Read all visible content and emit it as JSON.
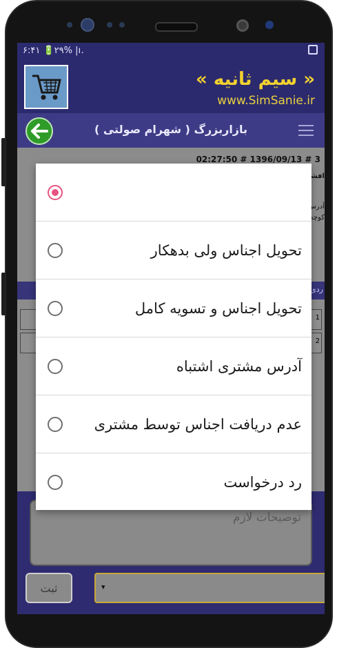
{
  "status_bar": {
    "left_text": "۶:۴۱ 🔋۲۹% |ı.",
    "right_icon": "image-icon"
  },
  "brand": {
    "title": "« سیم ثانیه »",
    "url": "www.SimSanie.ir",
    "title_color": "#f1d12f"
  },
  "nav": {
    "title": "بازاربزرگ ( شهرام صولتی )"
  },
  "background": {
    "order_line": "02:27:50 # 1396/09/13 # 3",
    "peek_1": "افشی",
    "peek_2": "آدرس",
    "peek_3": "کوچه",
    "table_header": "ردی",
    "row_1": "1",
    "row_2": "2"
  },
  "dialog": {
    "options": [
      {
        "label": "",
        "selected": true
      },
      {
        "label": "تحویل اجناس ولی بدهکار",
        "selected": false
      },
      {
        "label": "تحویل اجناس و تسویه کامل",
        "selected": false
      },
      {
        "label": "آدرس مشتری اشتباه",
        "selected": false
      },
      {
        "label": "عدم دریافت اجناس توسط مشتری",
        "selected": false
      },
      {
        "label": "رد درخواست",
        "selected": false
      }
    ],
    "accent": "#e8537f"
  },
  "form": {
    "notes_placeholder": "توصیحات لازم",
    "submit_label": "ثبت",
    "select_arrow": "▾"
  }
}
